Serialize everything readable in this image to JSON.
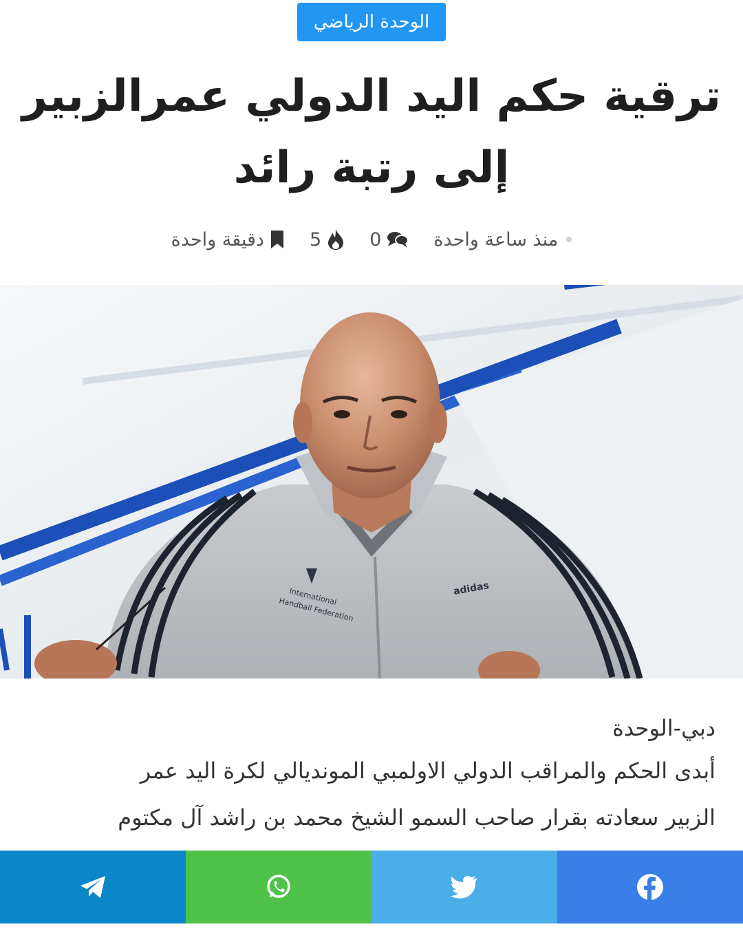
{
  "category": {
    "label": "الوحدة الرياضي"
  },
  "article": {
    "title_line1": "ترقية حكم اليد الدولي عمرالزبير",
    "title_line2": "إلى رتبة رائد",
    "meta": {
      "published": "منذ ساعة واحدة",
      "comments": "0",
      "views": "5",
      "read_time": "دقيقة واحدة"
    },
    "dateline": "دبي-الوحدة",
    "body_line1": "أبدى الحكم والمراقب الدولي الاولمبي المونديالي لكرة اليد عمر",
    "body_line2": "الزبير سعادته بقرار صاحب السمو الشيخ محمد بن راشد آل مكتوم"
  },
  "photo": {
    "jacket_brand": "adidas",
    "jacket_logo_line1": "International",
    "jacket_logo_line2": "Handball Federation"
  },
  "share": {
    "colors": {
      "telegram": "#0a86c9",
      "whatsapp": "#4fc24a",
      "twitter": "#4aaee8",
      "facebook": "#3a7ee8"
    },
    "icons": [
      "telegram-icon",
      "whatsapp-icon",
      "twitter-icon",
      "facebook-icon"
    ]
  },
  "colors": {
    "accent": "#2196f3"
  }
}
